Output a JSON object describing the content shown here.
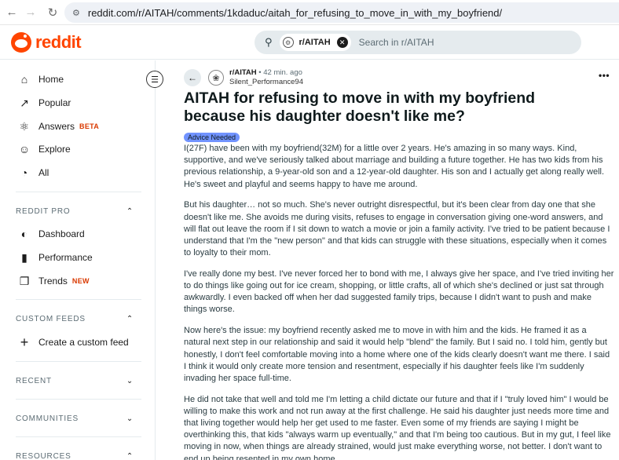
{
  "browser": {
    "url": "reddit.com/r/AITAH/comments/1kdaduc/aitah_for_refusing_to_move_in_with_my_boyfriend/",
    "icons": {
      "back": "arrow-left-icon",
      "forward": "arrow-right-icon",
      "reload": "reload-icon",
      "site_settings": "tune-icon"
    }
  },
  "header": {
    "logo_text": "reddit",
    "search": {
      "chip_label": "r/AITAH",
      "placeholder": "Search in r/AITAH"
    }
  },
  "sidebar": {
    "nav": [
      {
        "label": "Home",
        "icon": "home-icon"
      },
      {
        "label": "Popular",
        "icon": "popular-icon"
      },
      {
        "label": "Answers",
        "icon": "answers-icon",
        "badge": "BETA"
      },
      {
        "label": "Explore",
        "icon": "explore-icon"
      },
      {
        "label": "All",
        "icon": "all-icon"
      }
    ],
    "reddit_pro": {
      "title": "REDDIT PRO",
      "items": [
        {
          "label": "Dashboard",
          "icon": "dashboard-icon"
        },
        {
          "label": "Performance",
          "icon": "performance-icon"
        },
        {
          "label": "Trends",
          "icon": "trends-icon",
          "badge": "NEW"
        }
      ]
    },
    "custom_feeds": {
      "title": "CUSTOM FEEDS",
      "items": [
        {
          "label": "Create a custom feed",
          "icon": "plus-icon"
        }
      ]
    },
    "recent": {
      "title": "RECENT"
    },
    "communities": {
      "title": "COMMUNITIES"
    },
    "resources": {
      "title": "RESOURCES"
    }
  },
  "post": {
    "subreddit": "r/AITAH",
    "time": "• 42 min. ago",
    "author": "Silent_Performance94",
    "title": "AITAH for refusing to move in with my boyfriend because his daughter doesn't like me?",
    "flair": "Advice Needed",
    "paragraphs": [
      "I(27F) have been with my boyfriend(32M) for a little over 2 years. He's amazing in so many ways. Kind, supportive, and we've seriously talked about marriage and building a future together. He has two kids from his previous relationship, a 9-year-old son and a 12-year-old daughter. His son and I actually get along really well. He's sweet and playful and seems happy to have me around.",
      "But his daughter… not so much. She's never outright disrespectful, but it's been clear from day one that she doesn't like me. She avoids me during visits, refuses to engage in conversation giving one-word answers, and will flat out leave the room if I sit down to watch a movie or join a family activity. I've tried to be patient because I understand that I'm the \"new person\" and that kids can struggle with these situations, especially when it comes to loyalty to their mom.",
      "I've really done my best. I've never forced her to bond with me, I always give her space, and I've tried inviting her to do things like going out for ice cream, shopping, or little crafts, all of which she's declined or just sat through awkwardly. I even backed off when her dad suggested family trips, because I didn't want to push and make things worse.",
      "Now here's the issue: my boyfriend recently asked me to move in with him and the kids. He framed it as a natural next step in our relationship and said it would help \"blend\" the family. But I said no. I told him, gently but honestly, I don't feel comfortable moving into a home where one of the kids clearly doesn't want me there. I said I think it would only create more tension and resentment, especially if his daughter feels like I'm suddenly invading her space full-time.",
      "He did not take that well and told me I'm letting a child dictate our future and that if I \"truly loved him\" I would be willing to make this work and not run away at the first challenge. He said his daughter just needs more time and that living together would help her get used to me faster. Even some of my friends are saying I might be overthinking this, that kids \"always warm up eventually,\" and that I'm being too cautious. But in my gut, I feel like moving in now, when things are already strained, would just make everything worse, not better. I don't want to end up being resented in my own home."
    ]
  }
}
